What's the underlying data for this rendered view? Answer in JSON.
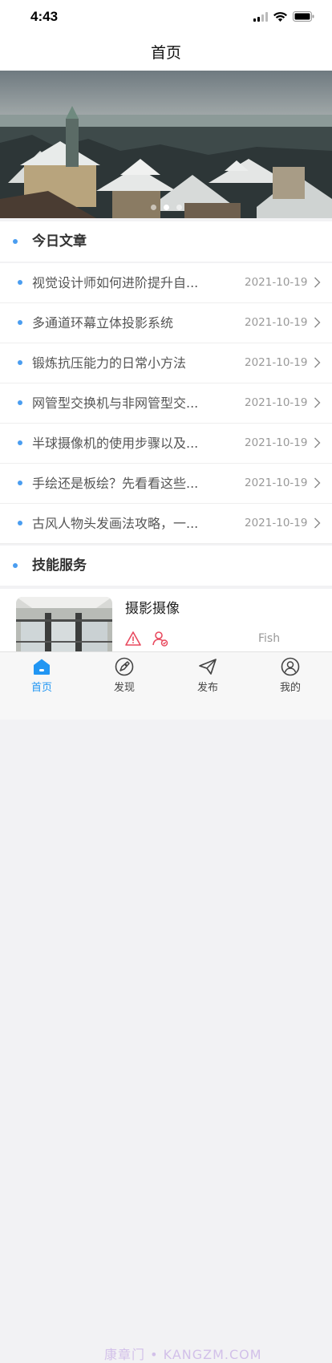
{
  "status_bar": {
    "time": "4:43"
  },
  "nav": {
    "title": "首页"
  },
  "banner": {
    "dot_count": 3,
    "active_dot": 1
  },
  "sections": {
    "articles": "今日文章",
    "services": "技能服务"
  },
  "articles": [
    {
      "title": "视觉设计师如何进阶提升自...",
      "date": "2021-10-19"
    },
    {
      "title": "多通道环幕立体投影系统",
      "date": "2021-10-19"
    },
    {
      "title": "锻炼抗压能力的日常小方法",
      "date": "2021-10-19"
    },
    {
      "title": "网管型交换机与非网管型交...",
      "date": "2021-10-19"
    },
    {
      "title": "半球摄像机的使用步骤以及...",
      "date": "2021-10-19"
    },
    {
      "title": "手绘还是板绘？先看看这些...",
      "date": "2021-10-19"
    },
    {
      "title": "古风人物头发画法攻略，一...",
      "date": "2021-10-19"
    }
  ],
  "service_card": {
    "title": "摄影摄像",
    "author": "Fish"
  },
  "tabs": [
    {
      "label": "首页",
      "icon": "home-icon",
      "active": true
    },
    {
      "label": "发现",
      "icon": "rocket-icon",
      "active": false
    },
    {
      "label": "发布",
      "icon": "send-icon",
      "active": false
    },
    {
      "label": "我的",
      "icon": "user-icon",
      "active": false
    }
  ],
  "watermark": "康章门 • KANGZM.COM",
  "colors": {
    "accent": "#2196f3",
    "bullet": "#4a9df0",
    "warn": "#e84a5f"
  }
}
